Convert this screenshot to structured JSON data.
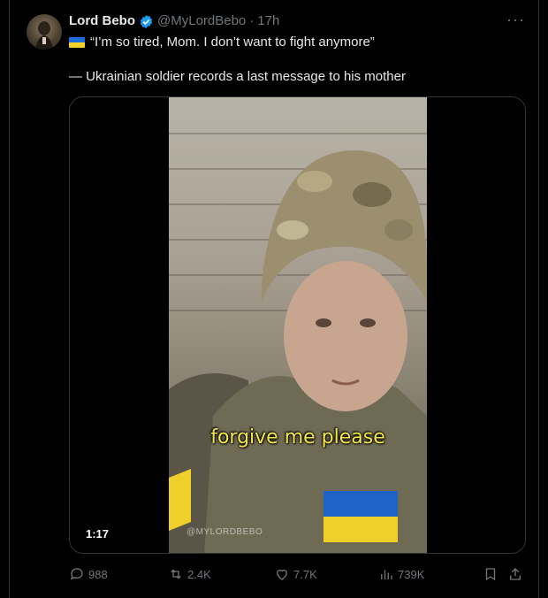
{
  "author": {
    "name": "Lord Bebo",
    "handle": "@MyLordBebo",
    "separator": "·",
    "time": "17h"
  },
  "more_label": "···",
  "post": {
    "line1": "“I’m so tired, Mom. I don’t want to fight anymore”",
    "line2": "— Ukrainian soldier records a last message to his mother"
  },
  "media": {
    "caption": "forgive me please",
    "watermark": "@MYLORDBEBO",
    "duration": "1:17"
  },
  "actions": {
    "replies": "988",
    "reposts": "2.4K",
    "likes": "7.7K",
    "views": "739K"
  },
  "colors": {
    "background": "#000000",
    "muted": "#71767b",
    "verified": "#1d9bf0",
    "caption": "#f3e64a"
  }
}
